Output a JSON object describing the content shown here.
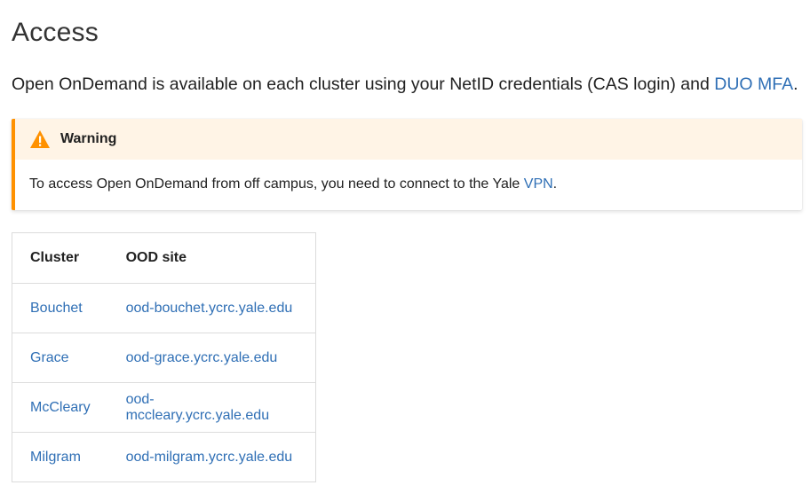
{
  "page": {
    "title": "Access",
    "intro_text": "Open OnDemand is available on each cluster using your NetID credentials (CAS login) and ",
    "intro_link": "DUO MFA",
    "intro_end": "."
  },
  "warning": {
    "icon": "warning-triangle-icon",
    "title": "Warning",
    "body_text": "To access Open OnDemand from off campus, you need to connect to the Yale ",
    "body_link": "VPN",
    "body_end": ".",
    "accent_color": "#ff9100",
    "title_background": "#fff4e6"
  },
  "table": {
    "headers": [
      "Cluster",
      "OOD site"
    ],
    "rows": [
      {
        "cluster": "Bouchet",
        "site": "ood-bouchet.ycrc.yale.edu"
      },
      {
        "cluster": "Grace",
        "site": "ood-grace.ycrc.yale.edu"
      },
      {
        "cluster": "McCleary",
        "site": "ood-mccleary.ycrc.yale.edu"
      },
      {
        "cluster": "Milgram",
        "site": "ood-milgram.ycrc.yale.edu"
      }
    ]
  },
  "colors": {
    "link": "#2f6fb5",
    "text": "#212121"
  }
}
